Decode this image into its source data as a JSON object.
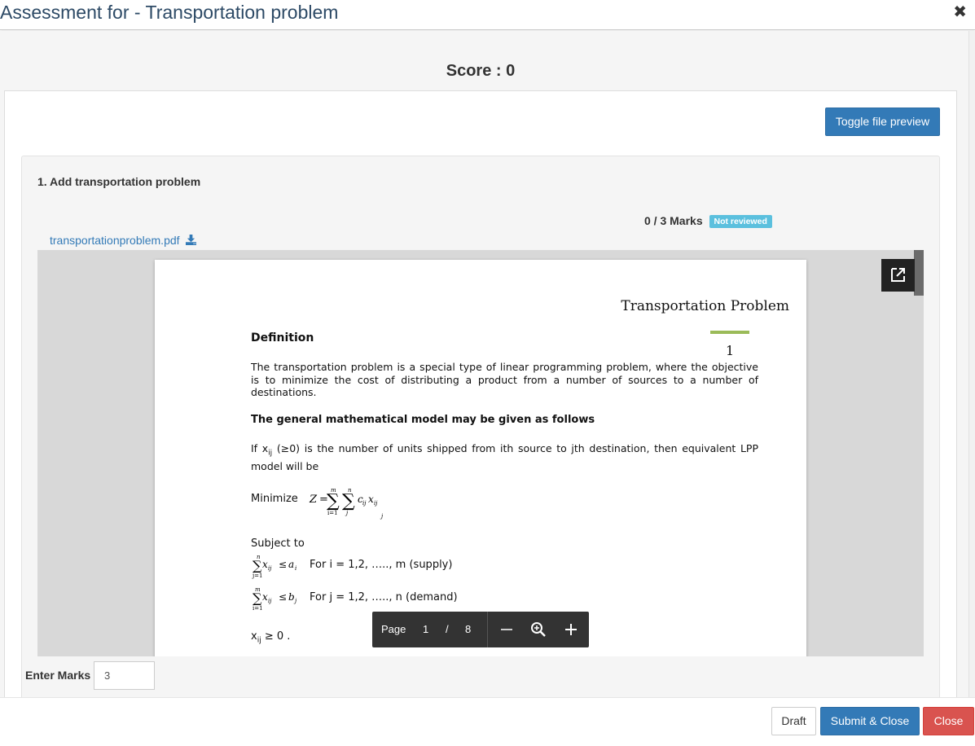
{
  "modal": {
    "title": "Assessment for - Transportation problem",
    "close_glyph": "✖"
  },
  "score": {
    "label": "Score : 0"
  },
  "toolbar": {
    "toggle_preview_label": "Toggle file preview"
  },
  "question": {
    "title": "1. Add transportation problem",
    "marks_text": "0 / 3 Marks",
    "status_badge": "Not reviewed",
    "file_name": "transportationproblem.pdf"
  },
  "pdf": {
    "header_title": "Transportation Problem",
    "page_number_printed": "1",
    "definition_heading": "Definition",
    "definition_text": "The transportation problem is a special type of linear programming problem, where the objective is to minimize the cost of distributing a product from a number of sources to a number of destinations.",
    "model_heading": "The general mathematical model may be given as follows",
    "model_intro_if": "If x",
    "model_intro_sub": "ij",
    "model_intro_rest": " (≥0) is the number of units shipped from ith source to jth destination, then equivalent LPP model will be",
    "minimize_label": "Minimize",
    "subject_to": "Subject to",
    "supply_text": "For i = 1,2, ….., m (supply)",
    "demand_text": "For j = 1,2, ….., n (demand)",
    "nonneg_text": " ≥ 0 ."
  },
  "pdf_toolbar": {
    "page_label": "Page",
    "current_page": "1",
    "separator": "/",
    "total_pages": "8"
  },
  "enter_marks": {
    "label": "Enter Marks",
    "value": "3"
  },
  "footer": {
    "draft_label": "Draft",
    "submit_label": "Submit & Close",
    "close_label": "Close"
  },
  "colors": {
    "primary": "#337ab7",
    "danger": "#d9534f",
    "info": "#5bc0de",
    "title": "#2d4a66",
    "accent_bar": "#9bbb59"
  }
}
